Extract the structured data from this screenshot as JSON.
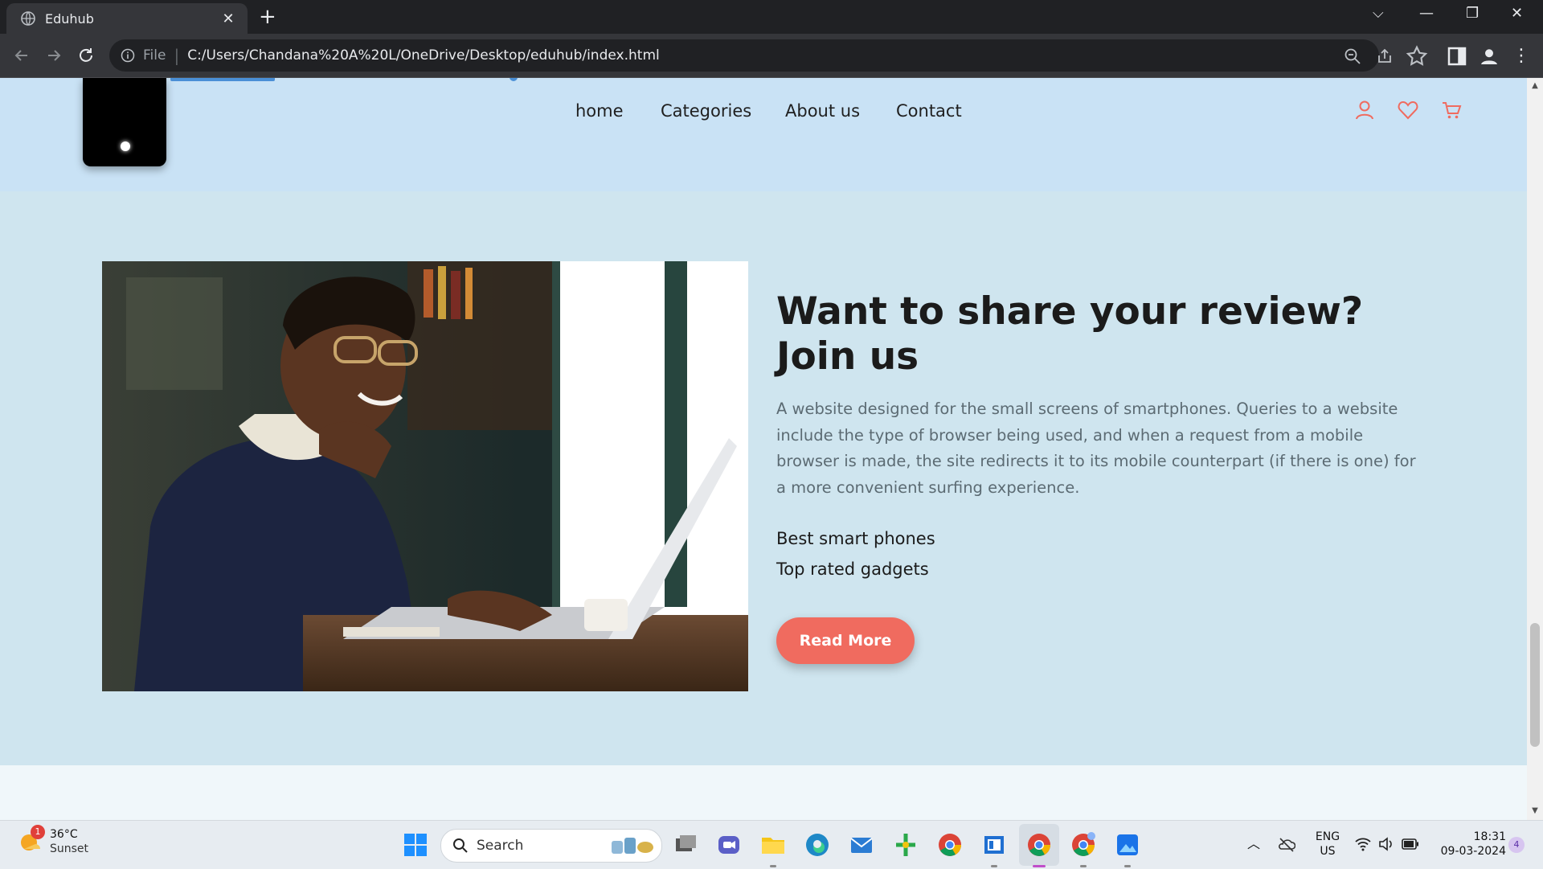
{
  "browser": {
    "tab_title": "Eduhub",
    "url_scheme": "File",
    "url": "C:/Users/Chandana%20A%20L/OneDrive/Desktop/eduhub/index.html"
  },
  "site": {
    "nav": [
      "home",
      "Categories",
      "About us",
      "Contact"
    ],
    "headline": "Want to share your review? Join us",
    "description": "A website designed for the small screens of smartphones. Queries to a website include the type of browser being used, and when a request from a mobile browser is made, the site redirects it to its mobile counterpart (if there is one) for a more convenient surfing experience.",
    "features": [
      "Best smart phones",
      "Top rated gadgets"
    ],
    "cta": "Read More",
    "accent_color": "#f06b5f"
  },
  "taskbar": {
    "weather_temp": "36°C",
    "weather_cond": "Sunset",
    "weather_badge": "1",
    "search_label": "Search",
    "lang_top": "ENG",
    "lang_bottom": "US",
    "time": "18:31",
    "date": "09-03-2024",
    "notif_count": "4"
  }
}
